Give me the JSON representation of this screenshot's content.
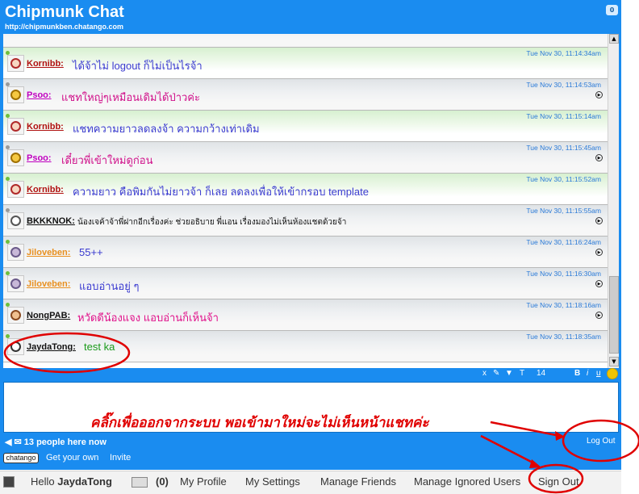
{
  "app": {
    "title": "Chipmunk Chat",
    "url": "http://chipmunkben.chatango.com",
    "notification_count": "0"
  },
  "messages": [
    {
      "name": "Kornibb:",
      "text": "ได้จ้าไม่ logout ก็ไม่เป็นไรจ้า",
      "time": "Tue Nov 30, 11:14:34am",
      "online": true,
      "style": "green",
      "name_color": "#b01010",
      "text_color": "#3a3ad0",
      "avatar": "kornibb"
    },
    {
      "name": "Psoo:",
      "text": "แชทใหญ่ๆเหมือนเดิมได้ป่าวค่ะ",
      "time": "Tue Nov 30, 11:14:53am",
      "online": false,
      "style": "grey",
      "name_color": "#c000c0",
      "text_color": "#d0108a",
      "avatar": "psoo",
      "play": true
    },
    {
      "name": "Kornibb:",
      "text": "แชทความยาวลดลงจ้า ความกว้างเท่าเดิม",
      "time": "Tue Nov 30, 11:15:14am",
      "online": true,
      "style": "green",
      "name_color": "#b01010",
      "text_color": "#3a3ad0",
      "avatar": "kornibb"
    },
    {
      "name": "Psoo:",
      "text": "เดี๋ยวพี่เข้าใหม่ดูก่อน",
      "time": "Tue Nov 30, 11:15:45am",
      "online": false,
      "style": "grey",
      "name_color": "#c000c0",
      "text_color": "#d0108a",
      "avatar": "psoo",
      "play": true
    },
    {
      "name": "Kornibb:",
      "text": "ความยาว คือพิมกันไม่ยาวจ้า ก็เลย ลดลงเพื่อให้เข้ากรอบ template",
      "time": "Tue Nov 30, 11:15:52am",
      "online": true,
      "style": "green",
      "name_color": "#b01010",
      "text_color": "#3a3ad0",
      "avatar": "kornibb"
    },
    {
      "name": "BKKKNOK:",
      "text": "น้องเจค้าจ้าพี่ฝากอีกเรื่องค่ะ ช่วยอธิบาย พี่แอน เรื่องมองไม่เห็นห้องแชตด้วยจ้า",
      "time": "Tue Nov 30, 11:15:55am",
      "online": false,
      "style": "grey",
      "name_color": "#111111",
      "text_color": "#111111",
      "avatar": "bkkknok",
      "play": true
    },
    {
      "name": "Jiloveben:",
      "text": "55++",
      "time": "Tue Nov 30, 11:16:24am",
      "online": true,
      "style": "grey",
      "name_color": "#e89020",
      "text_color": "#3a3ad0",
      "avatar": "jiloveben",
      "play": true
    },
    {
      "name": "Jiloveben:",
      "text": "แอบอ่านอยู่ ๆ",
      "time": "Tue Nov 30, 11:16:30am",
      "online": true,
      "style": "grey",
      "name_color": "#e89020",
      "text_color": "#3a3ad0",
      "avatar": "jiloveben",
      "play": true
    },
    {
      "name": "NongPAB:",
      "text": "หวัดดีน้องแจง แอบอ่านก็เห็นจ้า",
      "time": "Tue Nov 30, 11:18:16am",
      "online": true,
      "style": "grey",
      "name_color": "#111111",
      "text_color": "#e0108a",
      "avatar": "nongpab",
      "play": true
    },
    {
      "name": "JaydaTong:",
      "text": "test ka",
      "time": "Tue Nov 30, 11:18:35am",
      "online": true,
      "style": "grey",
      "name_color": "#111111",
      "text_color": "#1a9a1a",
      "avatar": "jaydatong"
    }
  ],
  "toolbar": {
    "close": "x",
    "bold": "B",
    "italic": "i",
    "underline": "u",
    "font": "T",
    "size": "14"
  },
  "footer": {
    "people": "13 people here now",
    "logout": "Log Out",
    "logo": "chatango",
    "get_your_own": "Get your own",
    "invite": "Invite"
  },
  "bottom_bar": {
    "greeting": "Hello",
    "username": "JaydaTong",
    "mail_count": "(0)",
    "my_profile": "My Profile",
    "my_settings": "My Settings",
    "manage_friends": "Manage Friends",
    "manage_ignored": "Manage Ignored Users",
    "sign_out": "Sign Out"
  },
  "annotation": {
    "text": "คลิ๊กเพื่อออกจากระบบ พอเข้ามาใหม่จะไม่เห็นหน้าแชทค่ะ",
    "color": "#e00000"
  }
}
